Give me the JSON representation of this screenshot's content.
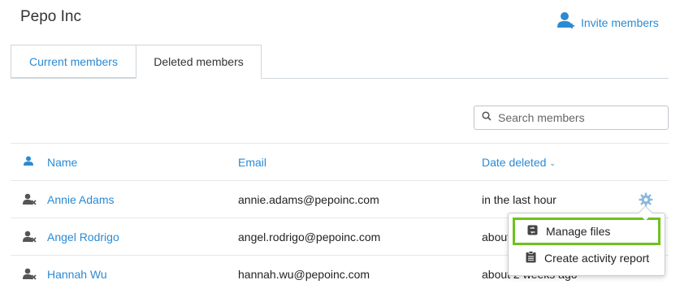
{
  "header": {
    "org_name": "Pepo Inc",
    "invite_label": "Invite members"
  },
  "tabs": [
    {
      "label": "Current members",
      "active": false
    },
    {
      "label": "Deleted members",
      "active": true
    }
  ],
  "search": {
    "placeholder": "Search members",
    "value": ""
  },
  "table": {
    "columns": {
      "name": "Name",
      "email": "Email",
      "date": "Date deleted",
      "sort_indicator": "⌄"
    },
    "rows": [
      {
        "name": "Annie Adams",
        "email": "annie.adams@pepoinc.com",
        "date": "in the last hour"
      },
      {
        "name": "Angel Rodrigo",
        "email": "angel.rodrigo@pepoinc.com",
        "date": "about 1 day ago"
      },
      {
        "name": "Hannah Wu",
        "email": "hannah.wu@pepoinc.com",
        "date": "about 2 weeks ago"
      }
    ]
  },
  "context_menu": {
    "items": [
      {
        "label": "Manage files",
        "icon": "manage-files-icon",
        "highlighted": true
      },
      {
        "label": "Create activity report",
        "icon": "clipboard-icon",
        "highlighted": false
      }
    ]
  },
  "colors": {
    "accent": "#2a8ad4",
    "highlight": "#6dc21d"
  }
}
